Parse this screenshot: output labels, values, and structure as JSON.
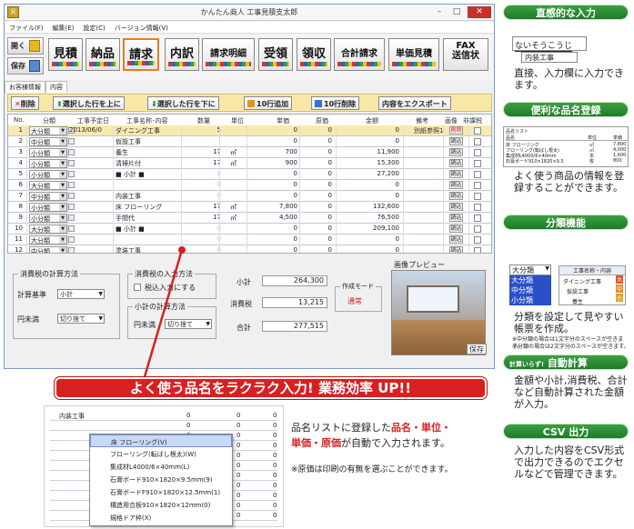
{
  "window": {
    "title": "かんたん商人 工事見積支太郎",
    "app_icon": "見積"
  },
  "menu": [
    "ファイル(F)",
    "編集(E)",
    "設定(C)",
    "バージョン情報(V)"
  ],
  "toolbar": {
    "open": "開く",
    "save": "保存",
    "tabs": [
      "見積",
      "納品",
      "請求",
      "内訳",
      "請求明細",
      "受領",
      "領収",
      "合計請求",
      "単価見積"
    ],
    "fax_line1": "FAX",
    "fax_line2": "送信状"
  },
  "subtabs": [
    "お客様情報",
    "内容"
  ],
  "actions": [
    "削除",
    "選択した行を上に",
    "選択した行を下に",
    "10行追加",
    "10行削除",
    "内容をエクスポート"
  ],
  "grid": {
    "headers": [
      "No.",
      "分類",
      "工事予定日",
      "工事名称･内容",
      "数量",
      "単位",
      "単価",
      "原価",
      "金額",
      "備考",
      "画像",
      "非課税"
    ],
    "rows": [
      {
        "no": "1",
        "cat": "大分類",
        "date": "2013/06/0",
        "name": "ダイニング工事",
        "qty": "5",
        "unit": "",
        "price": "0",
        "cost": "0",
        "amount": "0",
        "note": "別紙参照1",
        "img": "削除"
      },
      {
        "no": "2",
        "cat": "中分類",
        "date": "",
        "name": "仮設工事",
        "qty": "",
        "unit": "",
        "price": "0",
        "cost": "0",
        "amount": "0",
        "note": "",
        "img": "読込"
      },
      {
        "no": "3",
        "cat": "小分類",
        "date": "",
        "name": "養生",
        "qty": "17",
        "unit": "㎡",
        "price": "700",
        "cost": "0",
        "amount": "11,900",
        "note": "",
        "img": "読込"
      },
      {
        "no": "4",
        "cat": "小分類",
        "date": "",
        "name": "清掃片付",
        "qty": "17",
        "unit": "㎡",
        "price": "900",
        "cost": "0",
        "amount": "15,300",
        "note": "",
        "img": "読込"
      },
      {
        "no": "5",
        "cat": "小分類",
        "date": "",
        "name": "■ 小計 ■",
        "qty": "0",
        "unit": "",
        "price": "0",
        "cost": "0",
        "amount": "27,200",
        "note": "",
        "img": "読込"
      },
      {
        "no": "6",
        "cat": "大分類",
        "date": "",
        "name": "",
        "qty": "0",
        "unit": "",
        "price": "0",
        "cost": "0",
        "amount": "0",
        "note": "",
        "img": "読込"
      },
      {
        "no": "7",
        "cat": "中分類",
        "date": "",
        "name": "内装工事",
        "qty": "0",
        "unit": "",
        "price": "0",
        "cost": "0",
        "amount": "0",
        "note": "",
        "img": "読込"
      },
      {
        "no": "8",
        "cat": "小分類",
        "date": "",
        "name": "床 フローリング",
        "qty": "17",
        "unit": "㎡",
        "price": "7,800",
        "cost": "0",
        "amount": "132,600",
        "note": "",
        "img": "読込"
      },
      {
        "no": "9",
        "cat": "小分類",
        "date": "",
        "name": "手間代",
        "qty": "17",
        "unit": "㎡",
        "price": "4,500",
        "cost": "0",
        "amount": "76,500",
        "note": "",
        "img": "読込"
      },
      {
        "no": "10",
        "cat": "大分類",
        "date": "",
        "name": "■ 小計 ■",
        "qty": "0",
        "unit": "",
        "price": "0",
        "cost": "0",
        "amount": "209,100",
        "note": "",
        "img": "読込"
      },
      {
        "no": "11",
        "cat": "大分類",
        "date": "",
        "name": "",
        "qty": "0",
        "unit": "",
        "price": "0",
        "cost": "0",
        "amount": "0",
        "note": "",
        "img": "読込"
      },
      {
        "no": "12",
        "cat": "中分類",
        "date": "",
        "name": "塗装工事",
        "qty": "0",
        "unit": "",
        "price": "0",
        "cost": "0",
        "amount": "0",
        "note": "",
        "img": "読込"
      }
    ]
  },
  "bottom": {
    "tax_calc_title": "消費税の計算方法",
    "calc_base_label": "計算基準",
    "calc_base_value": "小計",
    "yen_label": "円未満",
    "yen_value": "切り捨て",
    "tax_input_title": "消費税の入力方法",
    "tax_exempt_label": "税込入力にする",
    "subtotal_calc_title": "小計の計算方法",
    "yen2_label": "円未満",
    "yen2_value": "切り捨て",
    "subtotal_label": "小計",
    "subtotal_value": "264,300",
    "tax_label": "消費税",
    "tax_value": "13,215",
    "total_label": "合計",
    "total_value": "277,515",
    "mode_title": "作成モード",
    "mode_value": "通常",
    "preview_title": "画像プレビュー",
    "preview_save": "保存"
  },
  "banner": "よく使う品名をラクラク入力! 業務効率 UP!!",
  "demo": {
    "field": "内装工事",
    "items": [
      "床 フローリング(V)",
      "フローリング(転ばし根太)(W)",
      "集成材L4000/6×40mm(L)",
      "石膏ボード910×1820×9.5mm(9)",
      "石膏ボードF910×1820×12.5mm(1)",
      "構造用合板910×1820×12mm(0)",
      "規格ドア枠(X)"
    ],
    "zeros": [
      "0",
      "0",
      "0",
      "0",
      "0",
      "0",
      "0",
      "0",
      "0",
      "0",
      "0"
    ]
  },
  "explain": {
    "line_a": "品名リストに登録した",
    "hl_a": "品名・単位・",
    "hl_b": "単価・原価",
    "line_b": "が自動で入力されます。",
    "note": "※原価は印刷の有無を選ぶことができます。"
  },
  "side": {
    "h1": "直感的な入力",
    "input_text": "ないそうこうじ",
    "input_suggest": "内装工事",
    "t1": "直接、入力欄に入力できます。",
    "h2": "便利な品名登録",
    "dict_title": "品名リスト",
    "dict_headers": [
      "品名",
      "単位",
      "単価"
    ],
    "dict_rows": [
      [
        "床 フローリング",
        "㎡",
        "7,800"
      ],
      [
        "フローリング(転ばし根太)",
        "㎡",
        "4,000"
      ],
      [
        "集成材L4000/6×40mm",
        "本",
        "1,600"
      ],
      [
        "石膏ボード910×1820×9.5",
        "枚",
        "800"
      ]
    ],
    "t2": "よく使う商品の情報を登録することができます。",
    "h3": "分類機能",
    "cat_sel": "大分類",
    "cat_opts": [
      "大分類",
      "中分類",
      "小分類"
    ],
    "cat_list_title": "工事名称・内容",
    "cat_list": [
      "ダイニング工事",
      "仮設工事",
      "養生"
    ],
    "cat_badges": [
      "大",
      "中",
      "小"
    ],
    "t3": "分類を設定して見やすい帳票を作成。",
    "t3_note1": "※中分類の場合は1文字分のスペースが空きます。",
    "t3_note2": "小分類の場合は2文字分のスペースが空きます。",
    "h4_small": "計算いらず!",
    "h4": "自動計算",
    "t4": "金額や小計,消費税、合計など自動計算された金額が入力。",
    "h5": "CSV 出力",
    "t5": "入力した内容をCSV形式で出力できるのでエクセルなどで管理できます。"
  },
  "colors": {
    "accent": "#d82020",
    "green": "#2a8a30",
    "selrow": "#f7e9b0"
  }
}
